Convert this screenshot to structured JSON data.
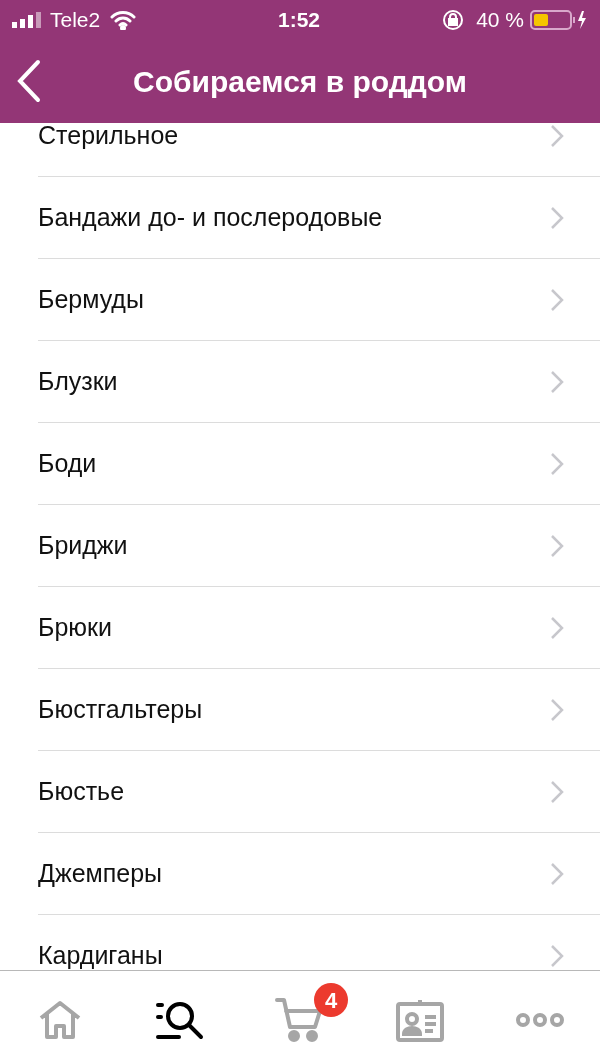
{
  "status_bar": {
    "carrier": "Tele2",
    "time": "1:52",
    "battery": "40 %"
  },
  "nav": {
    "title": "Собираемся в роддом"
  },
  "items": [
    "Стерильное",
    "Бандажи до- и послеродовые",
    "Бермуды",
    "Блузки",
    "Боди",
    "Бриджи",
    "Брюки",
    "Бюстгальтеры",
    "Бюстье",
    "Джемперы",
    "Кардиганы"
  ],
  "tab_bar": [
    {
      "kind": "home",
      "selected": false
    },
    {
      "kind": "search",
      "selected": true
    },
    {
      "kind": "cart",
      "selected": false,
      "badge": "4"
    },
    {
      "kind": "profile",
      "selected": false
    },
    {
      "kind": "more",
      "selected": false
    }
  ]
}
